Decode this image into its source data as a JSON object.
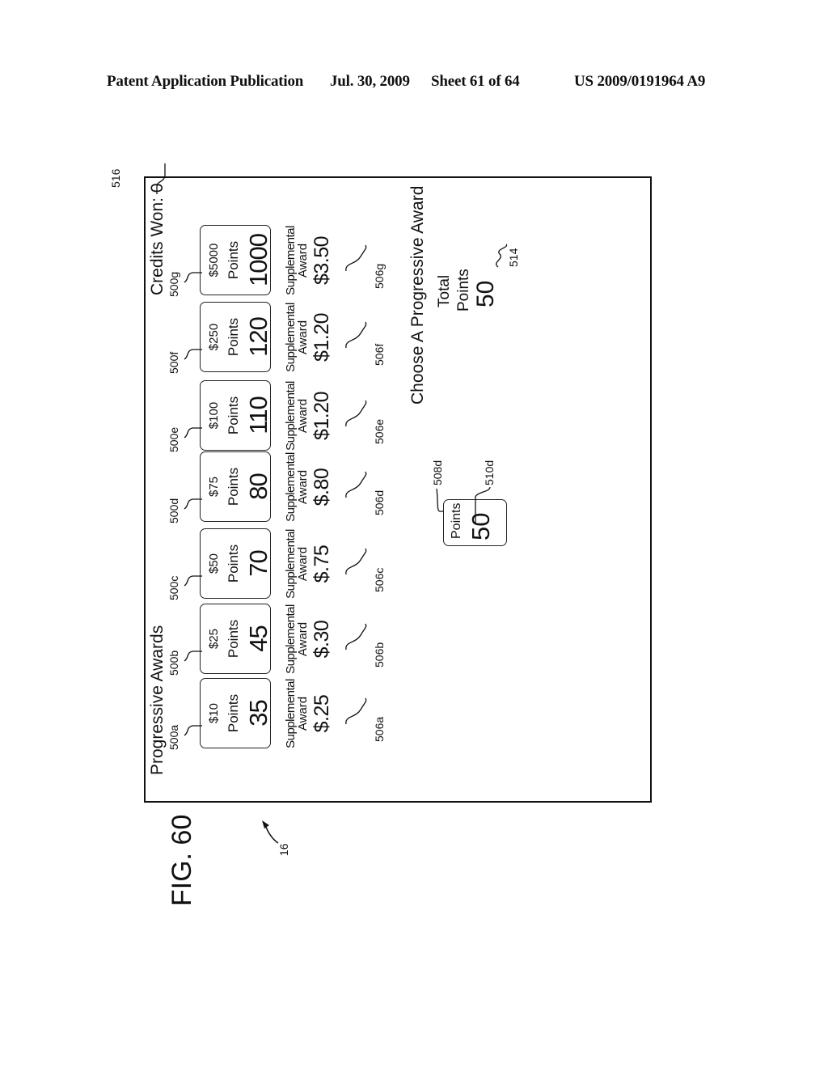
{
  "header": {
    "publication": "Patent Application Publication",
    "date": "Jul. 30, 2009",
    "sheet": "Sheet 61 of 64",
    "number": "US 2009/0191964 A9"
  },
  "figure": {
    "label": "FIG. 60",
    "ref": "16"
  },
  "screen": {
    "title": "Progressive Awards",
    "credits_label": "Credits Won: 0",
    "credits_ref": "516",
    "prompt": "Choose A Progressive Award",
    "total": {
      "line1": "Total",
      "line2": "Points",
      "value": "50",
      "ref": "514"
    },
    "selected_card": {
      "label": "Points",
      "value": "50",
      "ref_card": "508d",
      "ref_value": "510d"
    },
    "awards": [
      {
        "ref": "500a",
        "amount": "$10",
        "points_label": "Points",
        "points": "35",
        "supp_line1": "Supplemental",
        "supp_line2": "Award",
        "supp_value": "$.25",
        "supp_ref": "506a"
      },
      {
        "ref": "500b",
        "amount": "$25",
        "points_label": "Points",
        "points": "45",
        "supp_line1": "Supplemental",
        "supp_line2": "Award",
        "supp_value": "$.30",
        "supp_ref": "506b"
      },
      {
        "ref": "500c",
        "amount": "$50",
        "points_label": "Points",
        "points": "70",
        "supp_line1": "Supplemental",
        "supp_line2": "Award",
        "supp_value": "$.75",
        "supp_ref": "506c"
      },
      {
        "ref": "500d",
        "amount": "$75",
        "points_label": "Points",
        "points": "80",
        "supp_line1": "Supplemental",
        "supp_line2": "Award",
        "supp_value": "$.80",
        "supp_ref": "506d"
      },
      {
        "ref": "500e",
        "amount": "$100",
        "points_label": "Points",
        "points": "110",
        "supp_line1": "Supplemental",
        "supp_line2": "Award",
        "supp_value": "$1.20",
        "supp_ref": "506e"
      },
      {
        "ref": "500f",
        "amount": "$250",
        "points_label": "Points",
        "points": "120",
        "supp_line1": "Supplemental",
        "supp_line2": "Award",
        "supp_value": "$1.20",
        "supp_ref": "506f"
      },
      {
        "ref": "500g",
        "amount": "$5000",
        "points_label": "Points",
        "points": "1000",
        "supp_line1": "Supplemental",
        "supp_line2": "Award",
        "supp_value": "$3.50",
        "supp_ref": "506g"
      }
    ]
  }
}
